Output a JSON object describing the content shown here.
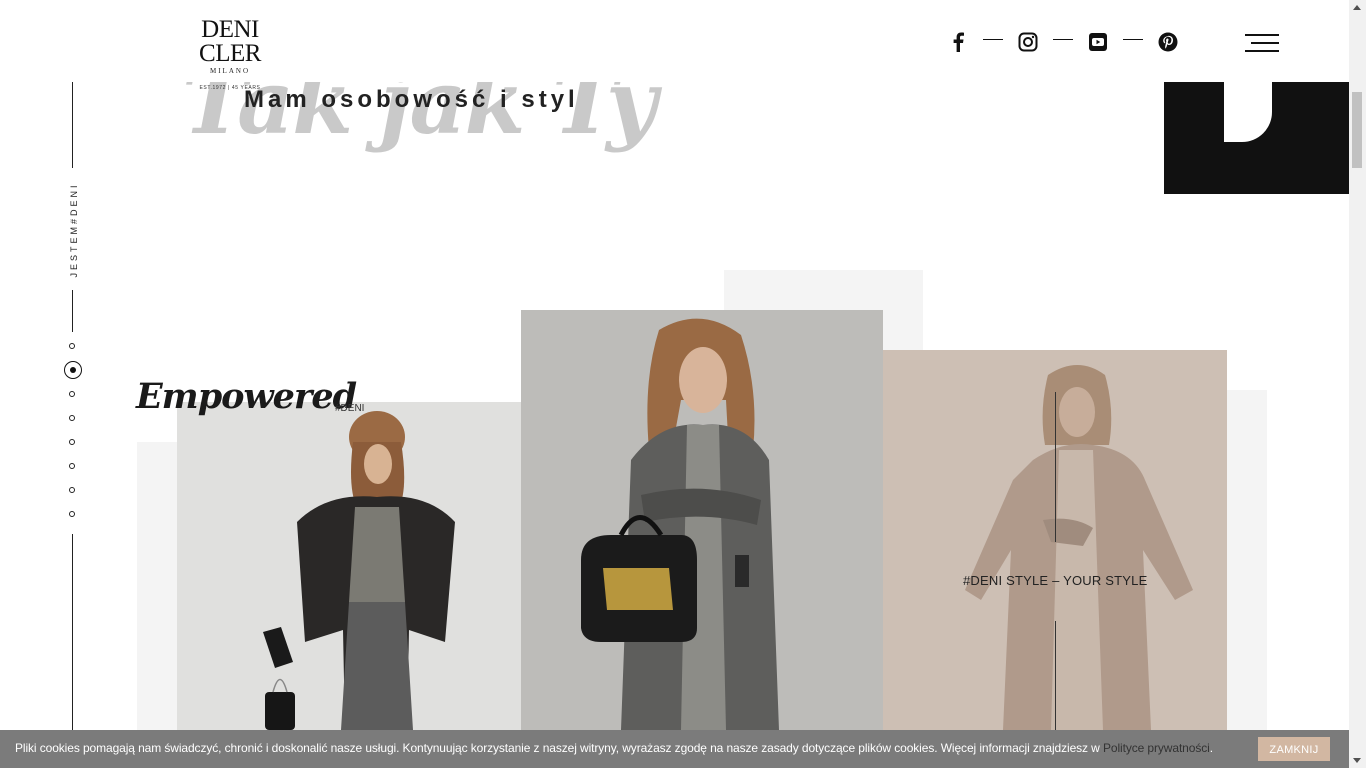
{
  "header": {
    "logo": {
      "brand": "DENI CLER",
      "city": "MILANO",
      "est": "EST.1972 | 45 YEARS"
    },
    "social": [
      {
        "name": "facebook-icon"
      },
      {
        "name": "instagram-icon"
      },
      {
        "name": "youtube-icon"
      },
      {
        "name": "pinterest-icon"
      }
    ]
  },
  "side_rail": {
    "label": "JESTEM#DENI",
    "dots_count": 8,
    "active_index": 1
  },
  "hero": {
    "background_script": "Tak jak Ty",
    "title": "Mam osobowość i styl"
  },
  "gallery": {
    "heading": "Empowered",
    "tag": "#DENI",
    "style_caption": "#DENI STYLE – YOUR STYLE"
  },
  "cookie_bar": {
    "text": "Pliki cookies pomagają nam świadczyć, chronić i doskonalić nasze usługi. Kontynuując korzystanie z naszej witryny, wyrażasz zgodę na nasze zasady dotyczące plików cookies. Więcej informacji znajdziesz w ",
    "link_text": "Polityce prywatności",
    "suffix": ".",
    "button": "ZAMKNIJ"
  },
  "colors": {
    "accent_button": "#d2b7a2",
    "cookie_bg": "#7b7b7b",
    "ink": "#111111",
    "panel_gray": "#f4f4f4"
  }
}
